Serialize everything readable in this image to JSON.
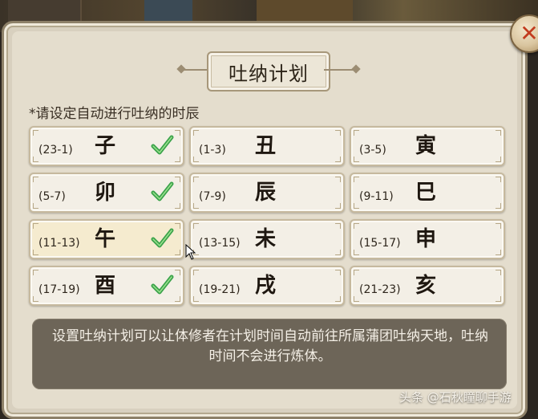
{
  "window": {
    "title": "吐纳计划",
    "close_icon": "close-icon"
  },
  "instruction": "*请设定自动进行吐纳的时辰",
  "slots": [
    {
      "branch": "子",
      "range": "(23-1)",
      "selected": true
    },
    {
      "branch": "丑",
      "range": "(1-3)",
      "selected": false
    },
    {
      "branch": "寅",
      "range": "(3-5)",
      "selected": false
    },
    {
      "branch": "卯",
      "range": "(5-7)",
      "selected": true
    },
    {
      "branch": "辰",
      "range": "(7-9)",
      "selected": false
    },
    {
      "branch": "巳",
      "range": "(9-11)",
      "selected": false
    },
    {
      "branch": "午",
      "range": "(11-13)",
      "selected": true
    },
    {
      "branch": "未",
      "range": "(13-15)",
      "selected": false
    },
    {
      "branch": "申",
      "range": "(15-17)",
      "selected": false
    },
    {
      "branch": "酉",
      "range": "(17-19)",
      "selected": true
    },
    {
      "branch": "戌",
      "range": "(19-21)",
      "selected": false
    },
    {
      "branch": "亥",
      "range": "(21-23)",
      "selected": false
    }
  ],
  "info": "设置吐纳计划可以让体修者在计划时间自动前往所属蒲团吐纳天地，吐纳时间不会进行炼体。",
  "watermark": "头条 @石秋瞳聊手游",
  "colors": {
    "panel": "#d8d0bf",
    "check": "#3aa24a",
    "close_x": "#c23c1f",
    "info_bg": "#6d6558"
  }
}
